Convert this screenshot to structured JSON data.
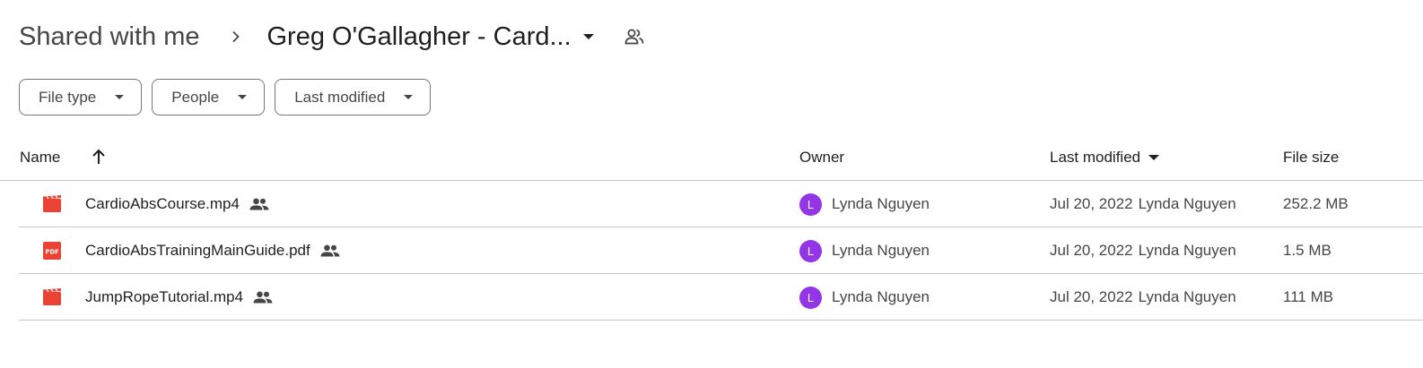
{
  "breadcrumb": {
    "root": "Shared with me",
    "current": "Greg O'Gallagher - Card..."
  },
  "filters": [
    {
      "label": "File type"
    },
    {
      "label": "People"
    },
    {
      "label": "Last modified"
    }
  ],
  "table": {
    "columns": {
      "name": "Name",
      "owner": "Owner",
      "last_modified": "Last modified",
      "file_size": "File size"
    },
    "sort": {
      "column": "Name",
      "direction": "ascending"
    },
    "rows": [
      {
        "icon": "video-file-icon",
        "name": "CardioAbsCourse.mp4",
        "shared": true,
        "owner_initial": "L",
        "owner": "Lynda Nguyen",
        "modified_date": "Jul 20, 2022",
        "modified_by": "Lynda Nguyen",
        "size": "252.2 MB"
      },
      {
        "icon": "pdf-file-icon",
        "name": "CardioAbsTrainingMainGuide.pdf",
        "shared": true,
        "owner_initial": "L",
        "owner": "Lynda Nguyen",
        "modified_date": "Jul 20, 2022",
        "modified_by": "Lynda Nguyen",
        "size": "1.5 MB"
      },
      {
        "icon": "video-file-icon",
        "name": "JumpRopeTutorial.mp4",
        "shared": true,
        "owner_initial": "L",
        "owner": "Lynda Nguyen",
        "modified_date": "Jul 20, 2022",
        "modified_by": "Lynda Nguyen",
        "size": "111 MB"
      }
    ]
  },
  "colors": {
    "avatar": "#9334e6",
    "file_icon_red": "#ea4335",
    "text_primary": "#1f1f1f",
    "text_secondary": "#444746",
    "divider": "#c7c7c7"
  }
}
